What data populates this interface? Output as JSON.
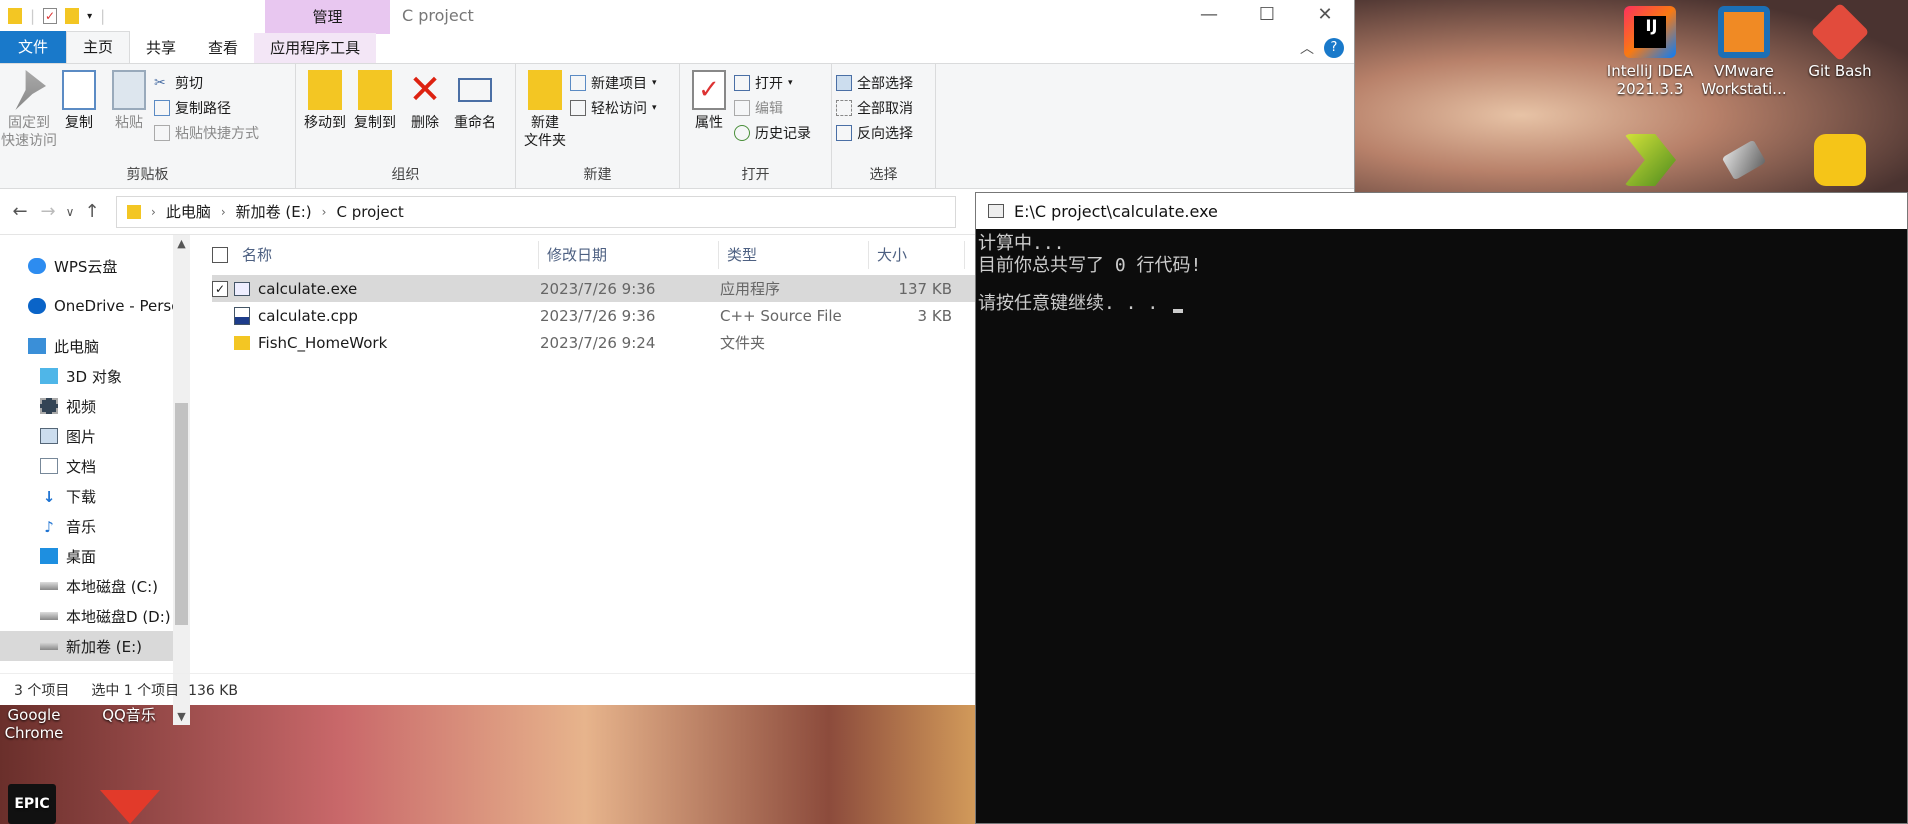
{
  "explorer": {
    "window_title": "C project",
    "context_tab": "管理",
    "ribbon_tabs": [
      "文件",
      "主页",
      "共享",
      "查看",
      "应用程序工具"
    ],
    "ribbon": {
      "clipboard": {
        "label": "剪贴板",
        "pin": "固定到\n快速访问",
        "copy": "复制",
        "paste": "粘贴",
        "cut": "剪切",
        "copy_path": "复制路径",
        "paste_shortcut": "粘贴快捷方式"
      },
      "organize": {
        "label": "组织",
        "move_to": "移动到",
        "copy_to": "复制到",
        "delete": "删除",
        "rename": "重命名"
      },
      "new": {
        "label": "新建",
        "new_folder": "新建\n文件夹",
        "new_item": "新建项目",
        "easy_access": "轻松访问"
      },
      "open": {
        "label": "打开",
        "properties": "属性",
        "open": "打开",
        "edit": "编辑",
        "history": "历史记录"
      },
      "select": {
        "label": "选择",
        "select_all": "全部选择",
        "select_none": "全部取消",
        "invert": "反向选择"
      }
    },
    "breadcrumb": [
      "此电脑",
      "新加卷 (E:)",
      "C project"
    ],
    "nav_items": [
      {
        "label": "WPS云盘",
        "icon": "cloud-icon"
      },
      {
        "label": "OneDrive - Perso",
        "icon": "onedrive-icon"
      },
      {
        "label": "此电脑",
        "icon": "computer-icon"
      },
      {
        "label": "3D 对象",
        "icon": "cube-icon"
      },
      {
        "label": "视频",
        "icon": "video-icon"
      },
      {
        "label": "图片",
        "icon": "picture-icon"
      },
      {
        "label": "文档",
        "icon": "document-icon"
      },
      {
        "label": "下载",
        "icon": "download-icon"
      },
      {
        "label": "音乐",
        "icon": "music-icon"
      },
      {
        "label": "桌面",
        "icon": "desktop-icon"
      },
      {
        "label": "本地磁盘 (C:)",
        "icon": "drive-icon"
      },
      {
        "label": "本地磁盘D (D:)",
        "icon": "drive-icon"
      },
      {
        "label": "新加卷 (E:)",
        "icon": "drive-icon"
      }
    ],
    "columns": [
      "名称",
      "修改日期",
      "类型",
      "大小"
    ],
    "files": [
      {
        "name": "calculate.exe",
        "date": "2023/7/26 9:36",
        "type": "应用程序",
        "size": "137 KB"
      },
      {
        "name": "calculate.cpp",
        "date": "2023/7/26 9:36",
        "type": "C++ Source File",
        "size": "3 KB"
      },
      {
        "name": "FishC_HomeWork",
        "date": "2023/7/26 9:24",
        "type": "文件夹",
        "size": ""
      }
    ],
    "status": {
      "count": "3 个项目",
      "selected": "选中 1 个项目  136 KB"
    }
  },
  "console": {
    "title": "E:\\C project\\calculate.exe",
    "lines": [
      "计算中...",
      "目前你总共写了 0 行代码!",
      "",
      "请按任意键继续. . . "
    ]
  },
  "desktop_icons": [
    {
      "label": "IntelliJ IDEA\n2021.3.3",
      "color": "#e8388b"
    },
    {
      "label": "VMware\nWorkstati...",
      "color": "#f08a24"
    },
    {
      "label": "Git Bash",
      "color": "#e24b3c"
    },
    {
      "label": "Google\nChrome",
      "color": "#2f9e4f"
    },
    {
      "label": "QQ音乐",
      "color": "#31c27c"
    }
  ]
}
